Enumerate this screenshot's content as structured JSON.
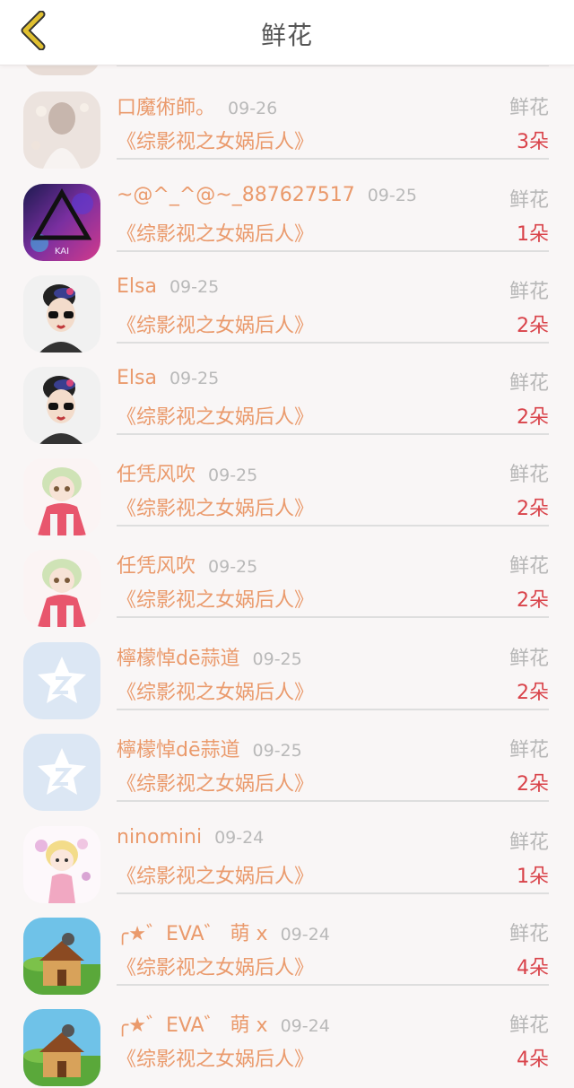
{
  "header": {
    "title": "鲜花",
    "back_icon": "chevron-left-icon",
    "back_color": "#e0c030"
  },
  "colors": {
    "name": "#ea9a6c",
    "date": "#b9b9b9",
    "count": "#d9434a",
    "type": "#b7b7b7"
  },
  "rows": [
    {
      "user": "口魔術師。",
      "date": "09-26",
      "type": "鲜花",
      "book": "《综影视之女娲后人》",
      "count": "3朵",
      "avatar": "avatar-girl-white-dress"
    },
    {
      "user": "~@^_^@~_887627517",
      "date": "09-25",
      "type": "鲜花",
      "book": "《综影视之女娲后人》",
      "count": "1朵",
      "avatar": "avatar-galaxy-triangle"
    },
    {
      "user": "Elsa",
      "date": "09-25",
      "type": "鲜花",
      "book": "《综影视之女娲后人》",
      "count": "2朵",
      "avatar": "avatar-girl-sunglasses"
    },
    {
      "user": "Elsa",
      "date": "09-25",
      "type": "鲜花",
      "book": "《综影视之女娲后人》",
      "count": "2朵",
      "avatar": "avatar-girl-sunglasses"
    },
    {
      "user": "任凭风吹",
      "date": "09-25",
      "type": "鲜花",
      "book": "《综影视之女娲后人》",
      "count": "2朵",
      "avatar": "avatar-anime-girl-pink"
    },
    {
      "user": "任凭风吹",
      "date": "09-25",
      "type": "鲜花",
      "book": "《综影视之女娲后人》",
      "count": "2朵",
      "avatar": "avatar-anime-girl-pink"
    },
    {
      "user": "檸檬悼dē蒜道",
      "date": "09-25",
      "type": "鲜花",
      "book": "《综影视之女娲后人》",
      "count": "2朵",
      "avatar": "avatar-default-star"
    },
    {
      "user": "檸檬悼dē蒜道",
      "date": "09-25",
      "type": "鲜花",
      "book": "《综影视之女娲后人》",
      "count": "2朵",
      "avatar": "avatar-default-star"
    },
    {
      "user": "ninomini",
      "date": "09-24",
      "type": "鲜花",
      "book": "《综影视之女娲后人》",
      "count": "1朵",
      "avatar": "avatar-chibi-flowers"
    },
    {
      "user": "╭★゛EVA゛ 萌 x",
      "date": "09-24",
      "type": "鲜花",
      "book": "《综影视之女娲后人》",
      "count": "4朵",
      "avatar": "avatar-game-house"
    },
    {
      "user": "╭★゛EVA゛ 萌 x",
      "date": "09-24",
      "type": "鲜花",
      "book": "《综影视之女娲后人》",
      "count": "4朵",
      "avatar": "avatar-game-house"
    }
  ]
}
